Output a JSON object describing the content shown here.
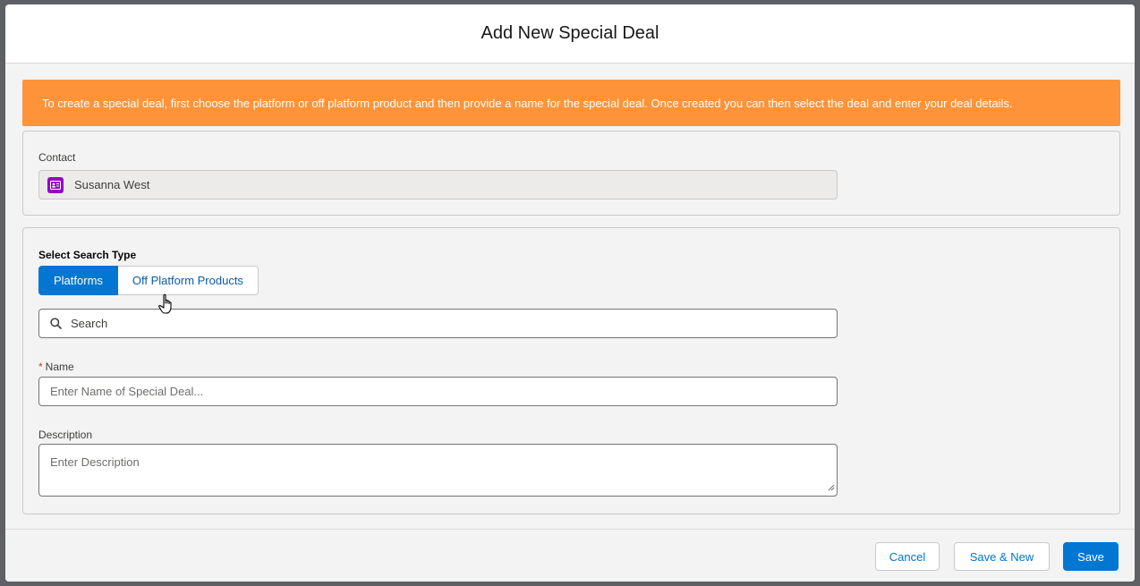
{
  "modal": {
    "title": "Add New Special Deal"
  },
  "banner": {
    "text": "To create a special deal, first choose the platform or off platform product and then provide a name for the special deal. Once created you can then select the deal and enter your deal details."
  },
  "contact": {
    "label": "Contact",
    "value": "Susanna West",
    "icon": "contact-card-icon",
    "icon_color": "#9602c7"
  },
  "search_type": {
    "label": "Select Search Type",
    "options": [
      "Platforms",
      "Off Platform Products"
    ],
    "selected": "Platforms"
  },
  "search": {
    "placeholder": "Search",
    "icon": "search-icon"
  },
  "name_field": {
    "required_mark": "*",
    "label": "Name",
    "placeholder": "Enter Name of Special Deal..."
  },
  "description_field": {
    "label": "Description",
    "placeholder": "Enter Description"
  },
  "footer": {
    "cancel_label": "Cancel",
    "save_new_label": "Save & New",
    "save_label": "Save"
  },
  "colors": {
    "brand": "#0176d3",
    "banner": "#fe9339"
  }
}
